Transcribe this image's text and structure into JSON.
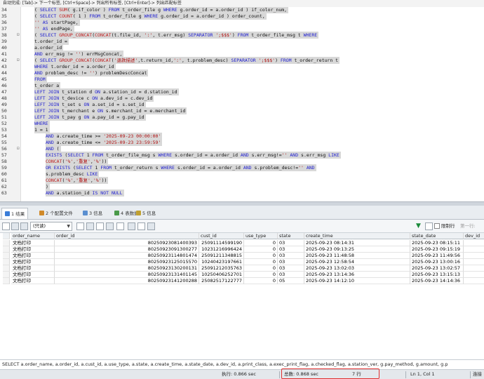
{
  "hint_bar": "自动完成: [Tab]-> 下一个标签, [Ctrl+Space]-> 列出所有标签, [Ctrl+Enter]-> 列出匹配标签",
  "editor": {
    "lines": [
      {
        "n": "34",
        "fold": "",
        "indent": 2,
        "segs": [
          [
            "tx",
            "( "
          ],
          [
            "kw",
            "SELECT"
          ],
          [
            "tx",
            " "
          ],
          [
            "fn",
            "SUM"
          ],
          [
            "tx",
            "( g.if_color ) "
          ],
          [
            "kw",
            "FROM"
          ],
          [
            "tx",
            " t_order_file g "
          ],
          [
            "kw",
            "WHERE"
          ],
          [
            "tx",
            " g.order_id = a.order_id ) if_color_num,"
          ]
        ]
      },
      {
        "n": "35",
        "fold": "",
        "indent": 2,
        "segs": [
          [
            "tx",
            "( "
          ],
          [
            "kw",
            "SELECT"
          ],
          [
            "tx",
            " "
          ],
          [
            "fn",
            "COUNT"
          ],
          [
            "tx",
            "( 1 ) "
          ],
          [
            "kw",
            "FROM"
          ],
          [
            "tx",
            " t_order_file g "
          ],
          [
            "kw",
            "WHERE"
          ],
          [
            "tx",
            " g.order_id = a.order_id ) order_count,"
          ]
        ]
      },
      {
        "n": "36",
        "fold": "",
        "indent": 2,
        "segs": [
          [
            "str",
            "'' "
          ],
          [
            "kw",
            "AS"
          ],
          [
            "tx",
            " startPage,"
          ]
        ]
      },
      {
        "n": "37",
        "fold": "",
        "indent": 2,
        "segs": [
          [
            "str",
            "'' "
          ],
          [
            "kw",
            "AS"
          ],
          [
            "tx",
            " endPage,"
          ]
        ]
      },
      {
        "n": "38",
        "fold": "⊟",
        "indent": 2,
        "segs": [
          [
            "tx",
            "( "
          ],
          [
            "kw",
            "SELECT"
          ],
          [
            "tx",
            " "
          ],
          [
            "fn",
            "GROUP_CONCAT"
          ],
          [
            "tx",
            "("
          ],
          [
            "fn",
            "CONCAT"
          ],
          [
            "tx",
            "(t.file_id, "
          ],
          [
            "str",
            "':'"
          ],
          [
            "tx",
            ", t.err_msg) "
          ],
          [
            "kw",
            "SEPARATOR"
          ],
          [
            "tx",
            " "
          ],
          [
            "str",
            "';$$$'"
          ],
          [
            "tx",
            ") "
          ],
          [
            "kw",
            "FROM"
          ],
          [
            "tx",
            " t_order_file_msg t "
          ],
          [
            "kw",
            "WHERE"
          ]
        ]
      },
      {
        "n": "39",
        "fold": "",
        "indent": 2,
        "segs": [
          [
            "tx",
            "t.order_id ="
          ]
        ]
      },
      {
        "n": "40",
        "fold": "",
        "indent": 2,
        "segs": [
          [
            "tx",
            "a.order_id"
          ]
        ]
      },
      {
        "n": "41",
        "fold": "",
        "indent": 2,
        "segs": [
          [
            "kw",
            "AND"
          ],
          [
            "tx",
            " err_msg != "
          ],
          [
            "str",
            "''"
          ],
          [
            "tx",
            ") errMsgConcat,"
          ]
        ]
      },
      {
        "n": "42",
        "fold": "⊟",
        "indent": 2,
        "segs": [
          [
            "tx",
            "( "
          ],
          [
            "kw",
            "SELECT"
          ],
          [
            "tx",
            " "
          ],
          [
            "fn",
            "GROUP_CONCAT"
          ],
          [
            "tx",
            "("
          ],
          [
            "fn",
            "CONCAT"
          ],
          [
            "tx",
            "("
          ],
          [
            "str",
            "'退款描述'"
          ],
          [
            "tx",
            ",t.return_id,"
          ],
          [
            "str",
            "':'"
          ],
          [
            "tx",
            ", t.problem_desc) "
          ],
          [
            "kw",
            "SEPARATOR"
          ],
          [
            "tx",
            " "
          ],
          [
            "str",
            "';$$$'"
          ],
          [
            "tx",
            ") "
          ],
          [
            "kw",
            "FROM"
          ],
          [
            "tx",
            " t_order_return t"
          ]
        ]
      },
      {
        "n": "43",
        "fold": "",
        "indent": 2,
        "segs": [
          [
            "kw",
            "WHERE"
          ],
          [
            "tx",
            " t.order_id = a.order_id"
          ]
        ]
      },
      {
        "n": "44",
        "fold": "",
        "indent": 2,
        "segs": [
          [
            "kw",
            "AND"
          ],
          [
            "tx",
            " problem_desc != "
          ],
          [
            "str",
            "''"
          ],
          [
            "tx",
            ") problemDescConcat"
          ]
        ]
      },
      {
        "n": "45",
        "fold": "",
        "indent": 2,
        "segs": [
          [
            "kw",
            "FROM"
          ]
        ]
      },
      {
        "n": "46",
        "fold": "",
        "indent": 2,
        "segs": [
          [
            "tx",
            "t_order a"
          ]
        ]
      },
      {
        "n": "47",
        "fold": "",
        "indent": 2,
        "segs": [
          [
            "kw",
            "LEFT JOIN"
          ],
          [
            "tx",
            " t_station d "
          ],
          [
            "kw",
            "ON"
          ],
          [
            "tx",
            " a.station_id = d.station_id"
          ]
        ]
      },
      {
        "n": "48",
        "fold": "",
        "indent": 2,
        "segs": [
          [
            "kw",
            "LEFT JOIN"
          ],
          [
            "tx",
            " t_device c "
          ],
          [
            "kw",
            "ON"
          ],
          [
            "tx",
            " a.dev_id = c.dev_id"
          ]
        ]
      },
      {
        "n": "49",
        "fold": "",
        "indent": 2,
        "segs": [
          [
            "kw",
            "LEFT JOIN"
          ],
          [
            "tx",
            " t_set s "
          ],
          [
            "kw",
            "ON"
          ],
          [
            "tx",
            " a.set_id = s.set_id"
          ]
        ]
      },
      {
        "n": "50",
        "fold": "",
        "indent": 2,
        "segs": [
          [
            "kw",
            "LEFT JOIN"
          ],
          [
            "tx",
            " t_merchant e "
          ],
          [
            "kw",
            "ON"
          ],
          [
            "tx",
            " s.merchant_id = e.merchant_id"
          ]
        ]
      },
      {
        "n": "51",
        "fold": "",
        "indent": 2,
        "segs": [
          [
            "kw",
            "LEFT JOIN"
          ],
          [
            "tx",
            " t_pay g "
          ],
          [
            "kw",
            "ON"
          ],
          [
            "tx",
            " a.pay_id = g.pay_id"
          ]
        ]
      },
      {
        "n": "52",
        "fold": "",
        "indent": 2,
        "segs": [
          [
            "kw",
            "WHERE"
          ]
        ]
      },
      {
        "n": "53",
        "fold": "",
        "indent": 2,
        "segs": [
          [
            "tx",
            "1 = 1"
          ]
        ]
      },
      {
        "n": "54",
        "fold": "",
        "indent": 4,
        "segs": [
          [
            "kw",
            "AND"
          ],
          [
            "tx",
            " a.create_time >= "
          ],
          [
            "str",
            "'2025-09-23 00:00:00'"
          ]
        ]
      },
      {
        "n": "55",
        "fold": "",
        "indent": 4,
        "segs": [
          [
            "kw",
            "AND"
          ],
          [
            "tx",
            " a.create_time <= "
          ],
          [
            "str",
            "'2025-09-23 23:59:59'"
          ]
        ]
      },
      {
        "n": "56",
        "fold": "⊟",
        "indent": 4,
        "segs": [
          [
            "kw",
            "AND"
          ],
          [
            "tx",
            " ("
          ]
        ]
      },
      {
        "n": "57",
        "fold": "",
        "indent": 4,
        "segs": [
          [
            "kw",
            "EXISTS"
          ],
          [
            "tx",
            " ("
          ],
          [
            "kw",
            "SELECT"
          ],
          [
            "tx",
            " 1 "
          ],
          [
            "kw",
            "FROM"
          ],
          [
            "tx",
            " t_order_file_msg s "
          ],
          [
            "kw",
            "WHERE"
          ],
          [
            "tx",
            " s.order_id = a.order_id "
          ],
          [
            "kw",
            "AND"
          ],
          [
            "tx",
            " s.err_msg!="
          ],
          [
            "str",
            "''"
          ],
          [
            "tx",
            " "
          ],
          [
            "kw",
            "AND"
          ],
          [
            "tx",
            " s.err_msg "
          ],
          [
            "kw",
            "LIKE"
          ]
        ]
      },
      {
        "n": "58",
        "fold": "",
        "indent": 4,
        "segs": [
          [
            "fn",
            "CONCAT"
          ],
          [
            "tx",
            "("
          ],
          [
            "str",
            "'%'"
          ],
          [
            "tx",
            ","
          ],
          [
            "str",
            "'重复'"
          ],
          [
            "tx",
            ","
          ],
          [
            "str",
            "'%'"
          ],
          [
            "tx",
            "))"
          ]
        ]
      },
      {
        "n": "59",
        "fold": "",
        "indent": 4,
        "segs": [
          [
            "kw",
            "OR EXISTS"
          ],
          [
            "tx",
            " ("
          ],
          [
            "kw",
            "SELECT"
          ],
          [
            "tx",
            " 1 "
          ],
          [
            "kw",
            "FROM"
          ],
          [
            "tx",
            " t_order_return s "
          ],
          [
            "kw",
            "WHERE"
          ],
          [
            "tx",
            " s.order_id = a.order_id "
          ],
          [
            "kw",
            "AND"
          ],
          [
            "tx",
            " s.problem_desc!="
          ],
          [
            "str",
            "''"
          ],
          [
            "tx",
            " "
          ],
          [
            "kw",
            "AND"
          ]
        ]
      },
      {
        "n": "60",
        "fold": "",
        "indent": 4,
        "segs": [
          [
            "tx",
            "s.problem_desc "
          ],
          [
            "kw",
            "LIKE"
          ]
        ]
      },
      {
        "n": "61",
        "fold": "",
        "indent": 4,
        "segs": [
          [
            "fn",
            "CONCAT"
          ],
          [
            "tx",
            "("
          ],
          [
            "str",
            "'%'"
          ],
          [
            "tx",
            ","
          ],
          [
            "str",
            "'重复'"
          ],
          [
            "tx",
            ","
          ],
          [
            "str",
            "'%'"
          ],
          [
            "tx",
            "))"
          ]
        ]
      },
      {
        "n": "62",
        "fold": "",
        "indent": 4,
        "segs": [
          [
            "tx",
            ")"
          ]
        ]
      },
      {
        "n": "63",
        "fold": "",
        "indent": 4,
        "segs": [
          [
            "kw",
            "AND"
          ],
          [
            "tx",
            " a.station_id "
          ],
          [
            "kw",
            "IS NOT NULL"
          ]
        ]
      }
    ]
  },
  "tabs": [
    {
      "label": "1 结果",
      "color": "#3b7dd8",
      "active": true
    },
    {
      "label": "2 个配置文件",
      "color": "#d08a2a",
      "active": false
    },
    {
      "label": "3 信息",
      "color": "#5a8fd0",
      "active": false
    },
    {
      "label": "4 表数据",
      "color": "#4a9a4a",
      "active": false
    },
    {
      "label": "5 信息",
      "color": "#c0a030",
      "active": false
    }
  ],
  "toolbar": {
    "filter_value": "(只读)",
    "limit_label": "限制行",
    "page_label": "第一行:"
  },
  "grid": {
    "columns": [
      "order_name",
      "order_id",
      "cust_id",
      "use_type",
      "state",
      "create_time",
      "state_date",
      "dev_id"
    ],
    "rows": [
      [
        "文档打印",
        "80250923081400393",
        "25091114599190",
        "0",
        "03",
        "2025-09-23 08:14:31",
        "2025-09-23 08:15:11",
        "13"
      ],
      [
        "文档打印",
        "80250923091300277",
        "10231216996424",
        "0",
        "03",
        "2025-09-23 09:13:25",
        "2025-09-23 09:15:19",
        "17"
      ],
      [
        "文档打印",
        "80250923114801474",
        "25091211348815",
        "0",
        "03",
        "2025-09-23 11:48:58",
        "2025-09-23 11:49:56",
        "17"
      ],
      [
        "文档打印",
        "80250923125015570",
        "10240423197661",
        "0",
        "03",
        "2025-09-23 12:58:54",
        "2025-09-23 13:00:16",
        "1"
      ],
      [
        "文档打印",
        "80250923130200131",
        "25091212035763",
        "0",
        "03",
        "2025-09-23 13:02:03",
        "2025-09-23 13:02:57",
        "22"
      ],
      [
        "文档打印",
        "80250923131401145",
        "10250406252701",
        "0",
        "03",
        "2025-09-23 13:14:36",
        "2025-09-23 13:15:13",
        "22"
      ],
      [
        "文档打印",
        "80250923141200288",
        "25082517122777",
        "0",
        "05",
        "2025-09-23 14:12:10",
        "2025-09-23 14:14:36",
        "22"
      ]
    ]
  },
  "sql_bar": "SELECT a.order_name, a.order_id, a.cust_id, a.use_type, a.state, a.create_time, a.state_date, a.dev_id, a.print_class, a.exec_print_flag, a.checked_flag, a.station_ver, g.pay_method, g.amount, g.p",
  "status": {
    "exec": "执行: 0.866 sec",
    "total": "总数: 0.868 sec",
    "rows": "7 行",
    "position": "Ln 1, Col 1",
    "connection": "连接"
  },
  "colors": {
    "keyword": "#1d1dd0",
    "function": "#c02020",
    "string": "#b01010",
    "highlight": "#d8d8d8",
    "status_box": "#e03030"
  }
}
